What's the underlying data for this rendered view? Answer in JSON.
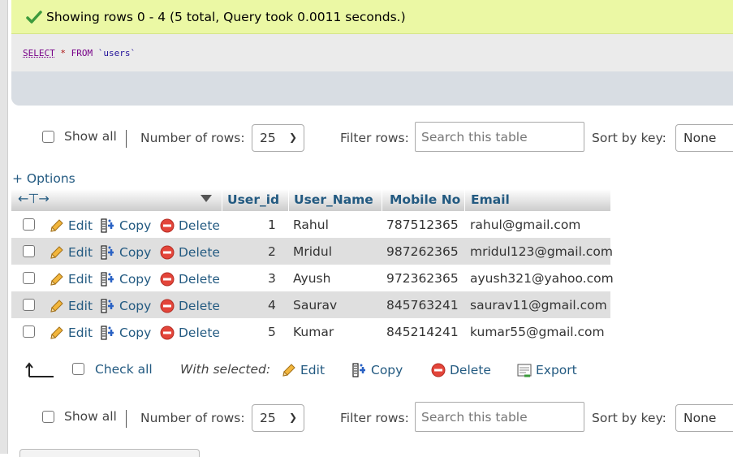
{
  "message": {
    "icon": "check-icon",
    "text": "Showing rows 0 - 4 (5 total, Query took 0.0011 seconds.)",
    "color": "#ebf8a4"
  },
  "sql": {
    "select": "SELECT",
    "star": "*",
    "from": "FROM",
    "table": "`users`"
  },
  "nav": {
    "show_all": "Show all",
    "number_of_rows_label": "Number of rows:",
    "number_of_rows_value": "25",
    "filter_label": "Filter rows:",
    "search_placeholder": "Search this table",
    "sort_label": "Sort by key:",
    "sort_value": "None"
  },
  "options_link": "+ Options",
  "table": {
    "columns": [
      "User_id",
      "User_Name",
      "Mobile No",
      "Email"
    ],
    "actions": {
      "edit": "Edit",
      "copy": "Copy",
      "delete": "Delete"
    },
    "rows": [
      {
        "id": "1",
        "name": "Rahul",
        "mobile": "787512365",
        "email": "rahul@gmail.com"
      },
      {
        "id": "2",
        "name": "Mridul",
        "mobile": "987262365",
        "email": "mridul123@gmail.com"
      },
      {
        "id": "3",
        "name": "Ayush",
        "mobile": "972362365",
        "email": "ayush321@yahoo.com"
      },
      {
        "id": "4",
        "name": "Saurav",
        "mobile": "845763241",
        "email": "saurav11@gmail.com"
      },
      {
        "id": "5",
        "name": "Kumar",
        "mobile": "845214241",
        "email": "kumar55@gmail.com"
      }
    ]
  },
  "with_selected": {
    "check_all": "Check all",
    "label": "With selected:",
    "edit": "Edit",
    "copy": "Copy",
    "delete": "Delete",
    "export": "Export"
  },
  "colors": {
    "link": "#235a81",
    "row_alt": "#dfdfdf"
  }
}
